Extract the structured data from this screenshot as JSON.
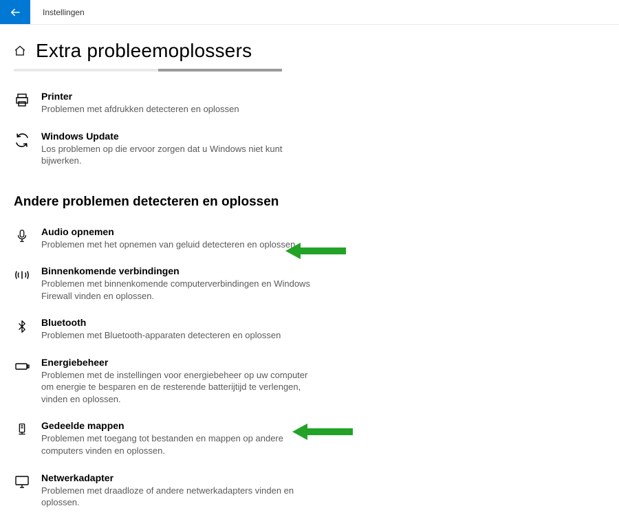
{
  "window": {
    "title": "Instellingen"
  },
  "page": {
    "title": "Extra probleemoplossers"
  },
  "group1": [
    {
      "title": "Printer",
      "desc": "Problemen met afdrukken detecteren en oplossen"
    },
    {
      "title": "Windows Update",
      "desc": "Los problemen op die ervoor zorgen dat u Windows niet kunt bijwerken."
    }
  ],
  "section2": {
    "heading": "Andere problemen detecteren en oplossen"
  },
  "group2": [
    {
      "title": "Audio opnemen",
      "desc": "Problemen met het opnemen van geluid detecteren en oplossen"
    },
    {
      "title": "Binnenkomende verbindingen",
      "desc": "Problemen met binnenkomende computerverbindingen en Windows Firewall vinden en oplossen."
    },
    {
      "title": "Bluetooth",
      "desc": "Problemen met Bluetooth-apparaten detecteren en oplossen"
    },
    {
      "title": "Energiebeheer",
      "desc": "Problemen met de instellingen voor energiebeheer op uw computer om energie te besparen en de resterende batterijtijd te verlengen, vinden en oplossen."
    },
    {
      "title": "Gedeelde mappen",
      "desc": "Problemen met toegang tot bestanden en mappen op andere computers vinden en oplossen."
    },
    {
      "title": "Netwerkadapter",
      "desc": "Problemen met draadloze of andere netwerkadapters vinden en oplossen."
    }
  ],
  "colors": {
    "accent": "#0078d4",
    "arrow": "#22a328"
  }
}
